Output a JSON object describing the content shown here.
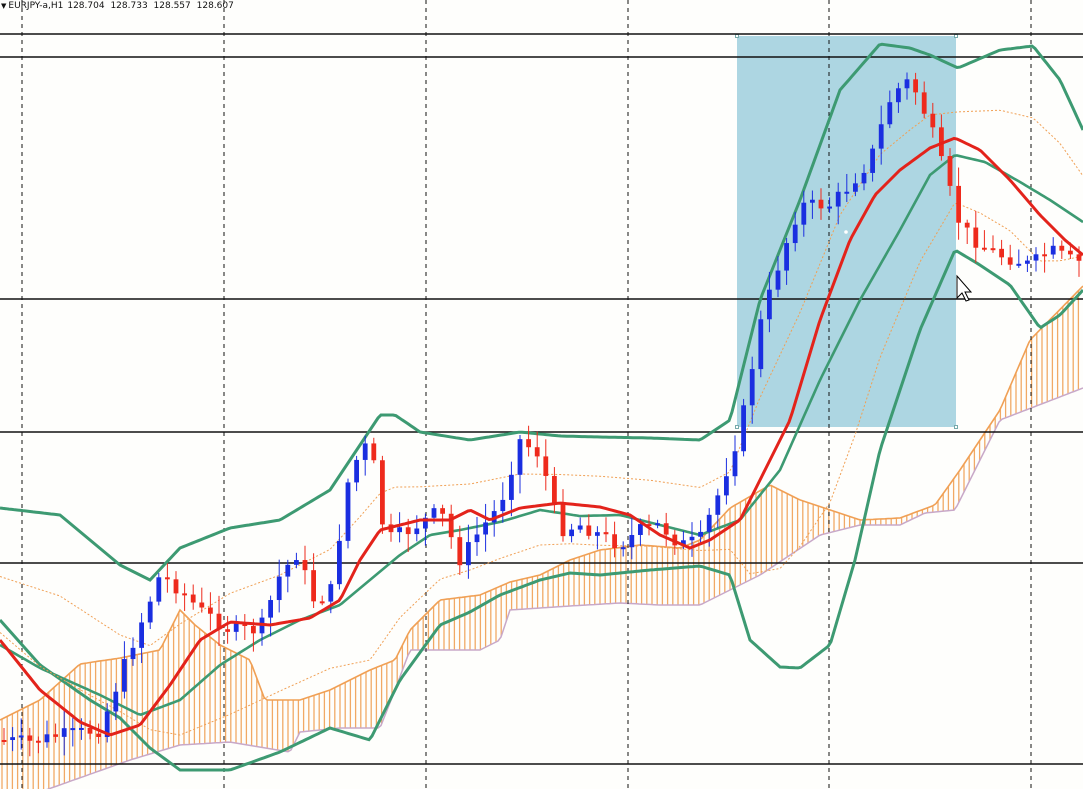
{
  "chart_window": {
    "symbol_label": "EURJPY-a,H1",
    "quotes": {
      "open": "128.704",
      "high": "128.733",
      "low": "128.557",
      "close": "128.607"
    },
    "dropdown_icon": "triangle-down-icon",
    "cursor_icon": "mouse-pointer-icon"
  },
  "colors": {
    "background": "#fefefc",
    "bull_candle": "#1a2ee0",
    "bear_candle": "#ee2a1c",
    "moving_average": "#e3231b",
    "bollinger_bands": "#3d9a72",
    "ichimoku_cloud": "#f0a055",
    "cloud_edge": "#c8a8c8",
    "signal_lines": "#f0a055",
    "selection_rectangle": "#a9d4e0",
    "horizontal_levels": "#111111",
    "period_separators": "#111111"
  },
  "chart_data": {
    "type": "candlestick",
    "symbol": "EURJPY-a",
    "timeframe": "H1",
    "y_axis_visible": false,
    "y_range_price_approx": [
      125.9,
      129.0
    ],
    "horizontal_levels_count": 6,
    "candles_visible_approx": 125,
    "indicators": [
      "moving-average",
      "bollinger-bands",
      "ichimoku-cloud"
    ],
    "selection_rectangle": "present"
  }
}
